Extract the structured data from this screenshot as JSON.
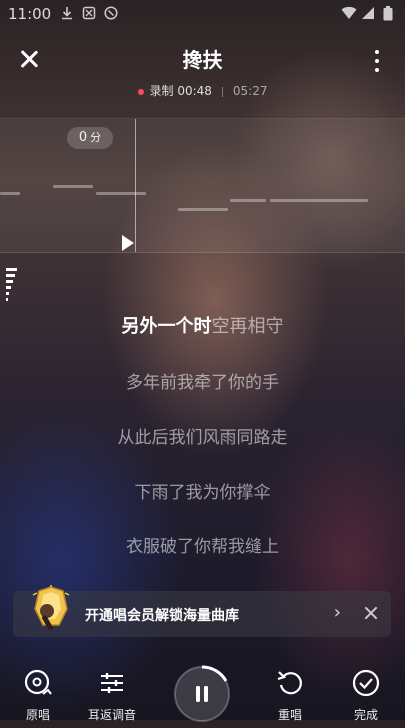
{
  "status_bar": {
    "time": "11:00"
  },
  "header": {
    "title": "搀扶"
  },
  "recording": {
    "label": "录制 00:48",
    "total": "05:27"
  },
  "score": {
    "value": "0",
    "unit": "分"
  },
  "lyrics": {
    "active_sung": "另外一个时",
    "active_rest": "空再相守",
    "upcoming": [
      "多年前我牵了你的手",
      "从此后我们风雨同路走",
      "下雨了我为你撑伞",
      "衣服破了你帮我缝上"
    ]
  },
  "vip_banner": {
    "text": "开通唱会员解锁海量曲库",
    "chevron": "›"
  },
  "bottom_bar": {
    "original_label": "原唱",
    "ear_return_label": "耳返调音",
    "restart_label": "重唱",
    "finish_label": "完成"
  },
  "colors": {
    "record_dot": "#ff4a5a",
    "vip_gold": "#f3c44a"
  }
}
